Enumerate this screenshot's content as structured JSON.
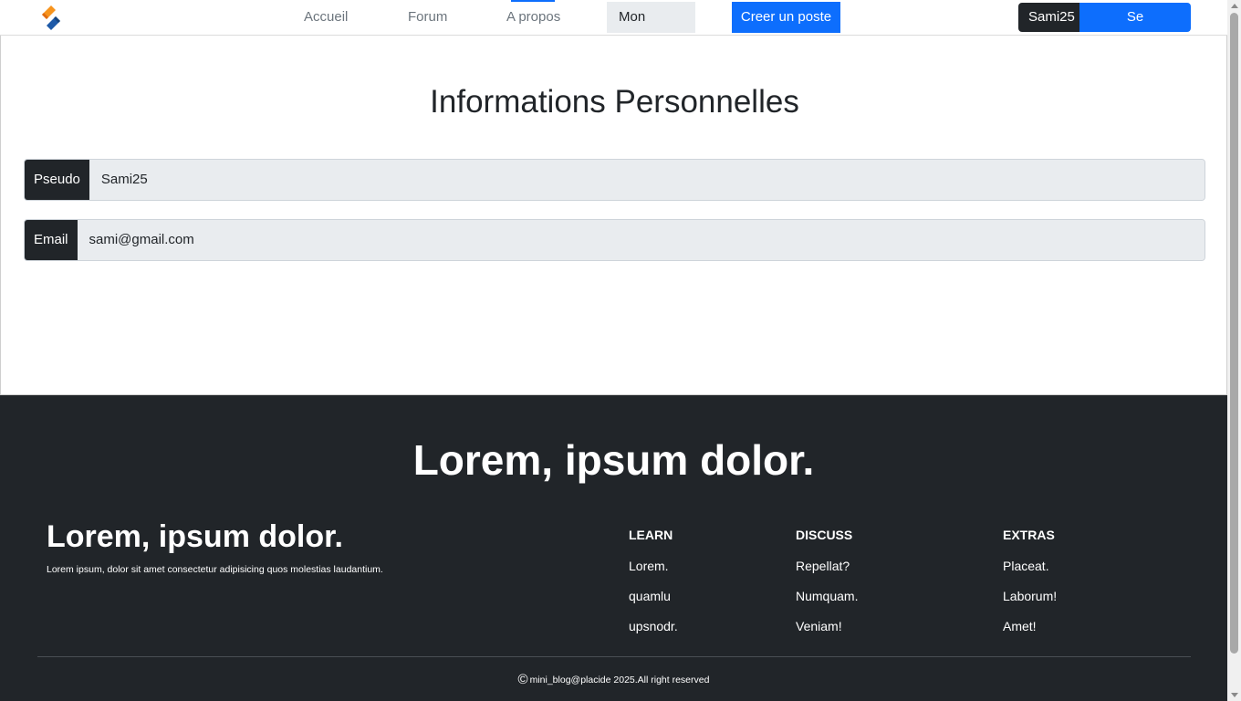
{
  "navbar": {
    "logo_icon": "site-logo-icon",
    "links": [
      {
        "label": "Accueil"
      },
      {
        "label": "Forum"
      },
      {
        "label": "A propos"
      },
      {
        "label": "Mon profile"
      }
    ],
    "create_post_label": "Creer un poste",
    "username": "Sami25",
    "logout_label": "Se deconnecter",
    "accent_color": "#0d6efd"
  },
  "profile": {
    "title": "Informations Personnelles",
    "fields": [
      {
        "label": "Pseudo",
        "value": "Sami25"
      },
      {
        "label": "Email",
        "value": "sami@gmail.com"
      }
    ]
  },
  "footer": {
    "hero": "Lorem, ipsum dolor.",
    "brand_title": "Lorem, ipsum dolor.",
    "brand_desc": "Lorem ipsum, dolor sit amet consectetur adipisicing quos molestias laudantium.",
    "columns": [
      {
        "heading": "LEARN",
        "links": [
          "Lorem.",
          "quamlu",
          "upsnodr."
        ]
      },
      {
        "heading": "DISCUSS",
        "links": [
          "Repellat?",
          "Numquam.",
          "Veniam!"
        ]
      },
      {
        "heading": "EXTRAS",
        "links": [
          "Placeat.",
          "Laborum!",
          "Amet!"
        ]
      }
    ],
    "copyright_symbol": "©",
    "copyright": "mini_blog@placide 2025.All right reserved",
    "background_color": "#212529"
  }
}
